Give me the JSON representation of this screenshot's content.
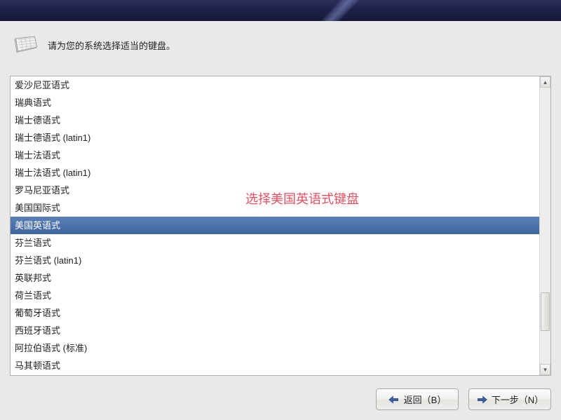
{
  "prompt": "请为您的系统选择适当的键盘。",
  "annotation": "选择美国英语式键盘",
  "keyboard_list": {
    "selected_index": 8,
    "items": [
      "爱沙尼亚语式",
      "瑞典语式",
      "瑞士德语式",
      "瑞士德语式 (latin1)",
      "瑞士法语式",
      "瑞士法语式 (latin1)",
      "罗马尼亚语式",
      "美国国际式",
      "美国英语式",
      "芬兰语式",
      "芬兰语式 (latin1)",
      "英联邦式",
      "荷兰语式",
      "葡萄牙语式",
      "西班牙语式",
      "阿拉伯语式 (标准)",
      "马其顿语式"
    ]
  },
  "buttons": {
    "back": "返回（B）",
    "next": "下一步（N）"
  },
  "chart_data": null
}
